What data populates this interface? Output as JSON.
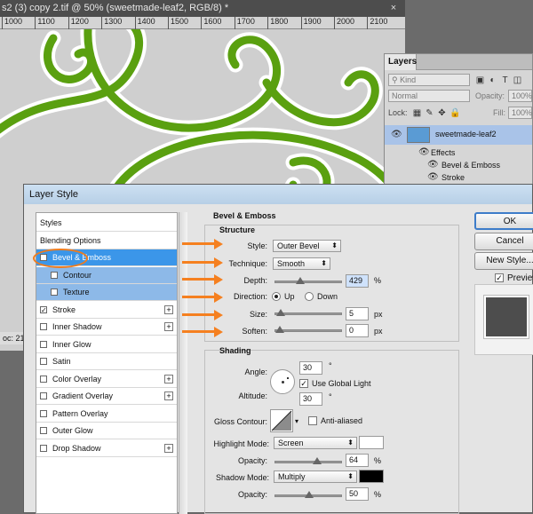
{
  "document": {
    "tab_title": "s2 (3) copy 2.tif @ 50% (sweetmade-leaf2, RGB/8) *",
    "close_glyph": "×",
    "ruler_labels": [
      "1000",
      "1100",
      "1200",
      "1300",
      "1400",
      "1500",
      "1600",
      "1700",
      "1800",
      "1900",
      "2000",
      "2100"
    ],
    "status_text": "oc: 21"
  },
  "layers_panel": {
    "title": "Layers",
    "kind_label": "Kind",
    "blend_mode": "Normal",
    "opacity_label": "Opacity:",
    "opacity_value": "100%",
    "lock_label": "Lock:",
    "fill_label": "Fill:",
    "fill_value": "100%",
    "layer_name": "sweetmade-leaf2",
    "effects_label": "Effects",
    "effect_items": [
      "Bevel & Emboss",
      "Stroke"
    ]
  },
  "dialog": {
    "title": "Layer Style",
    "styles_list": [
      {
        "label": "Styles",
        "checkbox": false,
        "plus": false
      },
      {
        "label": "Blending Options",
        "checkbox": false,
        "plus": false
      },
      {
        "label": "Bevel & Emboss",
        "checkbox": true,
        "checked": true,
        "plus": false,
        "selected": true
      },
      {
        "label": "Contour",
        "checkbox": true,
        "checked": false,
        "plus": false,
        "sub": true
      },
      {
        "label": "Texture",
        "checkbox": true,
        "checked": false,
        "plus": false,
        "sub": true
      },
      {
        "label": "Stroke",
        "checkbox": true,
        "checked": true,
        "plus": true
      },
      {
        "label": "Inner Shadow",
        "checkbox": true,
        "checked": false,
        "plus": true
      },
      {
        "label": "Inner Glow",
        "checkbox": true,
        "checked": false,
        "plus": false
      },
      {
        "label": "Satin",
        "checkbox": true,
        "checked": false,
        "plus": false
      },
      {
        "label": "Color Overlay",
        "checkbox": true,
        "checked": false,
        "plus": true
      },
      {
        "label": "Gradient Overlay",
        "checkbox": true,
        "checked": false,
        "plus": true
      },
      {
        "label": "Pattern Overlay",
        "checkbox": true,
        "checked": false,
        "plus": false
      },
      {
        "label": "Outer Glow",
        "checkbox": true,
        "checked": false,
        "plus": false
      },
      {
        "label": "Drop Shadow",
        "checkbox": true,
        "checked": false,
        "plus": true
      }
    ],
    "bevel": {
      "section_title": "Bevel & Emboss",
      "structure_title": "Structure",
      "style_label": "Style:",
      "style_value": "Outer Bevel",
      "technique_label": "Technique:",
      "technique_value": "Smooth",
      "depth_label": "Depth:",
      "depth_value": "429",
      "depth_unit": "%",
      "depth_slider_fraction": 0.35,
      "direction_label": "Direction:",
      "direction_up": "Up",
      "direction_down": "Down",
      "size_label": "Size:",
      "size_value": "5",
      "size_unit": "px",
      "size_slider_fraction": 0.02,
      "soften_label": "Soften:",
      "soften_value": "0",
      "soften_unit": "px",
      "soften_slider_fraction": 0.0
    },
    "shading": {
      "title": "Shading",
      "angle_label": "Angle:",
      "angle_value": "30",
      "degree_symbol": "°",
      "global_light_label": "Use Global Light",
      "altitude_label": "Altitude:",
      "altitude_value": "30",
      "gloss_label": "Gloss Contour:",
      "anti_aliased_label": "Anti-aliased",
      "highlight_mode_label": "Highlight Mode:",
      "highlight_mode_value": "Screen",
      "highlight_color": "#ffffff",
      "highlight_opacity_label": "Opacity:",
      "highlight_opacity_value": "64",
      "highlight_opacity_fraction": 0.64,
      "shadow_mode_label": "Shadow Mode:",
      "shadow_mode_value": "Multiply",
      "shadow_color": "#000000",
      "shadow_opacity_label": "Opacity:",
      "shadow_opacity_value": "50",
      "shadow_opacity_fraction": 0.5,
      "percent": "%"
    },
    "buttons": {
      "ok": "OK",
      "cancel": "Cancel",
      "new_style": "New Style...",
      "preview": "Preview"
    }
  },
  "colors": {
    "leaf_green": "#5aa010",
    "annotation_orange": "#f58020",
    "selection_blue": "#3b96e9"
  }
}
